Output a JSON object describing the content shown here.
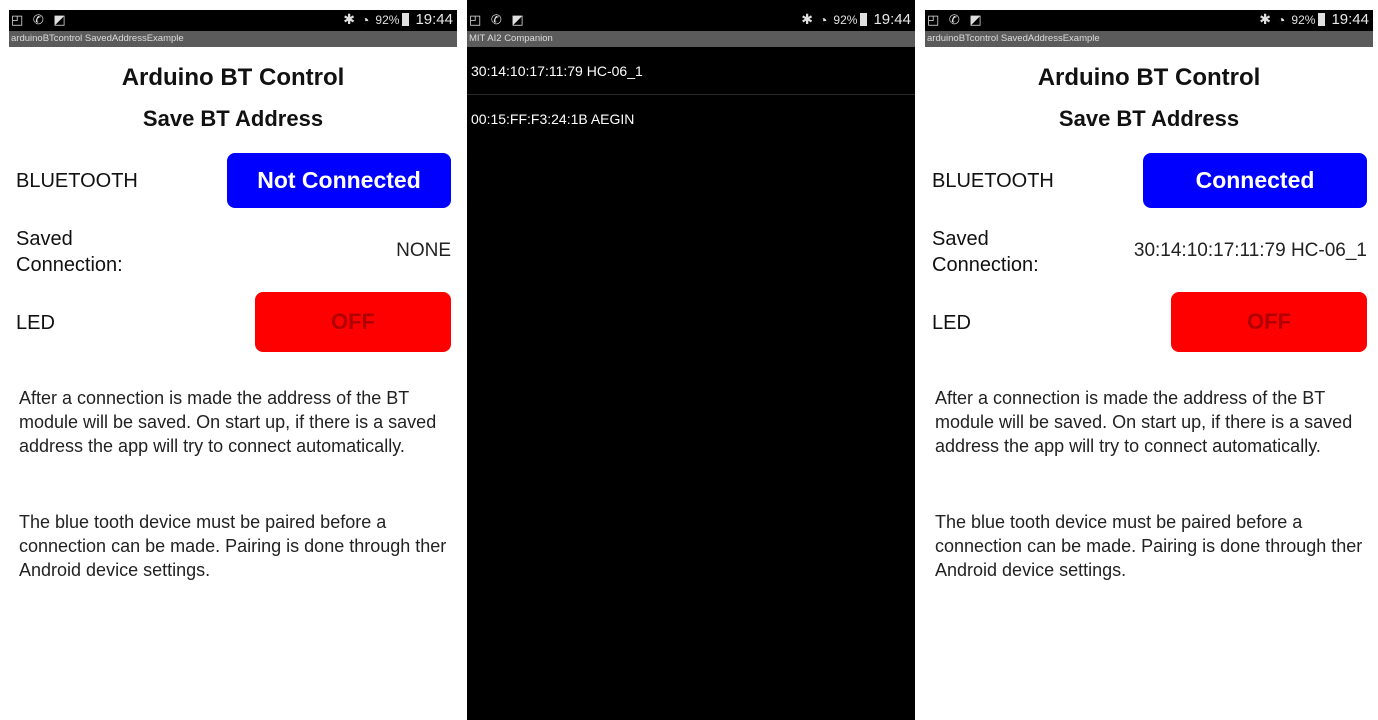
{
  "status_bar": {
    "left_icons": "◰ ✆ ◩",
    "bluetooth_icon": "bluetooth-icon",
    "wifi_icon": "wifi-icon",
    "battery": "92%",
    "time": "19:44"
  },
  "screen1": {
    "titlebar": "arduinoBTcontrol SavedAddressExample",
    "title": "Arduino BT Control",
    "subtitle": "Save BT Address",
    "bluetooth_label": "BLUETOOTH",
    "bluetooth_button": "Not Connected",
    "saved_label": "Saved Connection:",
    "saved_value": "NONE",
    "led_label": "LED",
    "led_button": "OFF",
    "paragraph1": "After a connection is made the address of the BT module will be saved. On start up, if there is a saved address the app will try to connect automatically.",
    "paragraph2": "The blue tooth device must be paired before a connection can be made. Pairing is done through ther Android device settings."
  },
  "screen2": {
    "titlebar": "MIT AI2 Companion",
    "devices": [
      "30:14:10:17:11:79 HC-06_1",
      "00:15:FF:F3:24:1B AEGIN"
    ]
  },
  "screen3": {
    "titlebar": "arduinoBTcontrol SavedAddressExample",
    "title": "Arduino BT Control",
    "subtitle": "Save BT Address",
    "bluetooth_label": "BLUETOOTH",
    "bluetooth_button": "Connected",
    "saved_label": "Saved Connection:",
    "saved_value": "30:14:10:17:11:79 HC-06_1",
    "led_label": "LED",
    "led_button": "OFF",
    "paragraph1": "After a connection is made the address of the BT module will be saved. On start up, if there is a saved address the app will try to connect automatically.",
    "paragraph2": "The blue tooth device must be paired before a connection can be made. Pairing is done through ther Android device settings."
  },
  "colors": {
    "bt_button": "#0000ff",
    "led_button": "#ff0000",
    "led_text": "#b00000",
    "titlebar": "#5b5b5b",
    "statusbar": "#000000"
  }
}
